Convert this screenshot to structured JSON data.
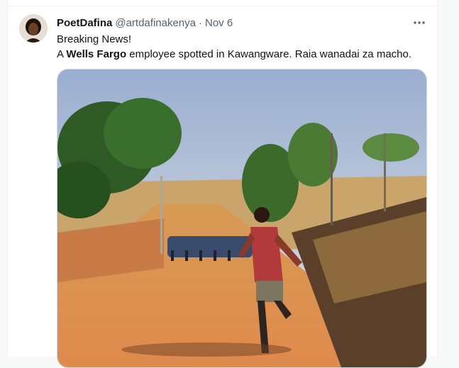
{
  "tweet": {
    "display_name": "PoetDafina",
    "handle": "@artdafinakenya",
    "separator": "·",
    "date": "Nov 6",
    "more_icon": "more-horizontal-icon",
    "lines": {
      "line1": "Breaking News!",
      "line2_prefix": "A ",
      "line2_bold": "Wells Fargo",
      "line2_suffix": " employee spotted in Kawangware. Raia wanadai za macho."
    }
  },
  "colors": {
    "text_primary": "#0f1419",
    "text_secondary": "#536471",
    "border": "#cfd9de"
  }
}
